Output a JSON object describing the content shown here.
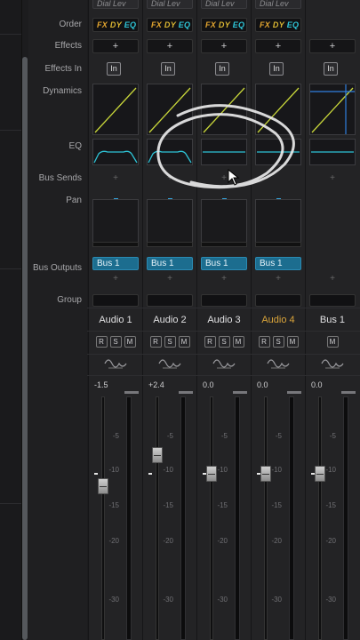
{
  "row_labels": {
    "order": "Order",
    "effects": "Effects",
    "effects_in": "Effects In",
    "dynamics": "Dynamics",
    "eq": "EQ",
    "bus_sends": "Bus Sends",
    "pan": "Pan",
    "bus_outputs": "Bus Outputs",
    "group": "Group"
  },
  "strips": [
    {
      "name": "Audio 1",
      "dial": "Dial Lev",
      "order": {
        "fx": "FX",
        "dy": "DY",
        "eq": "EQ"
      },
      "effects_add": "+",
      "effects_in": "In",
      "bus_send": "+",
      "bus_output": "Bus 1",
      "bus_output_add": "+",
      "buttons": [
        "R",
        "S",
        "M"
      ],
      "volume": "-1.5",
      "selected": false
    },
    {
      "name": "Audio 2",
      "dial": "Dial Lev",
      "order": {
        "fx": "FX",
        "dy": "DY",
        "eq": "EQ"
      },
      "effects_add": "+",
      "effects_in": "In",
      "bus_send": "+",
      "bus_output": "Bus 1",
      "bus_output_add": "+",
      "buttons": [
        "R",
        "S",
        "M"
      ],
      "volume": "+2.4",
      "selected": false
    },
    {
      "name": "Audio 3",
      "dial": "Dial Lev",
      "order": {
        "fx": "FX",
        "dy": "DY",
        "eq": "EQ"
      },
      "effects_add": "+",
      "effects_in": "In",
      "bus_send": "+",
      "bus_output": "Bus 1",
      "bus_output_add": "+",
      "buttons": [
        "R",
        "S",
        "M"
      ],
      "volume": "0.0",
      "selected": false
    },
    {
      "name": "Audio 4",
      "dial": "Dial Lev",
      "order": {
        "fx": "FX",
        "dy": "DY",
        "eq": "EQ"
      },
      "effects_add": "+",
      "effects_in": "In",
      "bus_send": "",
      "bus_output": "Bus 1",
      "bus_output_add": "+",
      "buttons": [
        "R",
        "S",
        "M"
      ],
      "volume": "0.0",
      "selected": true
    },
    {
      "name": "Bus 1",
      "dial": "",
      "order": null,
      "effects_add": "+",
      "effects_in": "In",
      "bus_send": "+",
      "bus_output": "",
      "bus_output_add": "+",
      "buttons": [
        "M"
      ],
      "volume": "0.0",
      "selected": false
    }
  ],
  "fader_scale": [
    "0",
    "-5",
    "-10",
    "-15",
    "-20",
    "-30"
  ],
  "colors": {
    "accent_blue": "#1c6d8f",
    "selected_name": "#d9a43a",
    "dyn_curve": "#c8d63a",
    "eq_curve": "#2ec4d6"
  }
}
